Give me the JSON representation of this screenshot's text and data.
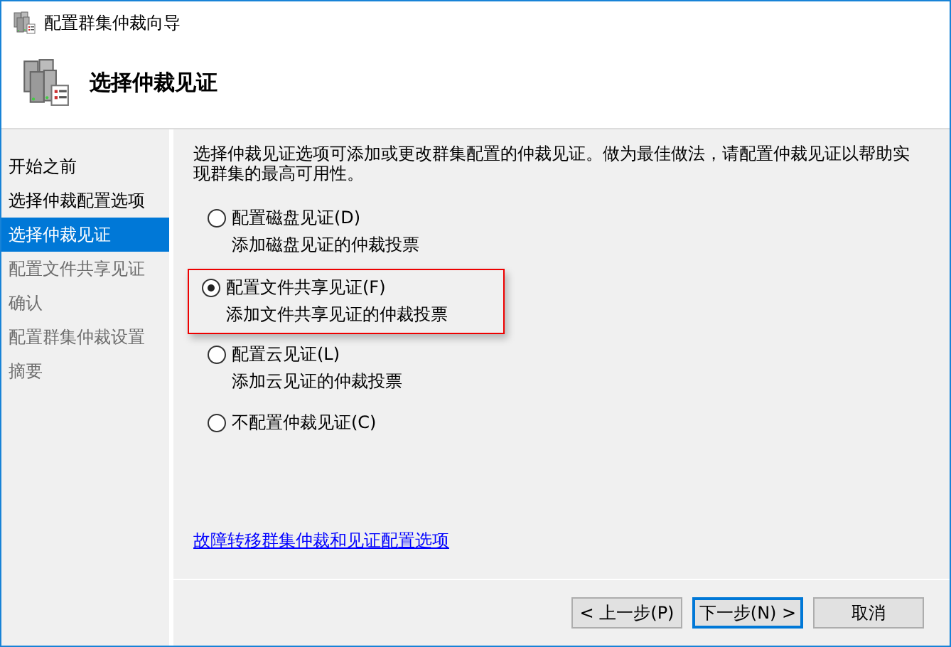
{
  "window": {
    "title": "配置群集仲裁向导"
  },
  "header": {
    "title": "选择仲裁见证"
  },
  "steps": [
    {
      "label": "开始之前",
      "selected": false,
      "disabled": false
    },
    {
      "label": "选择仲裁配置选项",
      "selected": false,
      "disabled": false
    },
    {
      "label": "选择仲裁见证",
      "selected": true,
      "disabled": false
    },
    {
      "label": "配置文件共享见证",
      "selected": false,
      "disabled": true
    },
    {
      "label": "确认",
      "selected": false,
      "disabled": true
    },
    {
      "label": "配置群集仲裁设置",
      "selected": false,
      "disabled": true
    },
    {
      "label": "摘要",
      "selected": false,
      "disabled": true
    }
  ],
  "description": "选择仲裁见证选项可添加或更改群集配置的仲裁见证。做为最佳做法，请配置仲裁见证以帮助实现群集的最高可用性。",
  "options": [
    {
      "label": "配置磁盘见证(D)",
      "detail": "添加磁盘见证的仲裁投票",
      "selected": false,
      "highlighted": false
    },
    {
      "label": "配置文件共享见证(F)",
      "detail": "添加文件共享见证的仲裁投票",
      "selected": true,
      "highlighted": true
    },
    {
      "label": "配置云见证(L)",
      "detail": "添加云见证的仲裁投票",
      "selected": false,
      "highlighted": false
    },
    {
      "label": "不配置仲裁见证(C)",
      "selected": false,
      "highlighted": false
    }
  ],
  "link": "故障转移群集仲裁和见证配置选项",
  "buttons": [
    {
      "label": "< 上一步(P)",
      "kind": "normal"
    },
    {
      "label": "下一步(N) >",
      "kind": "default"
    },
    {
      "label": "取消",
      "kind": "normal"
    }
  ]
}
